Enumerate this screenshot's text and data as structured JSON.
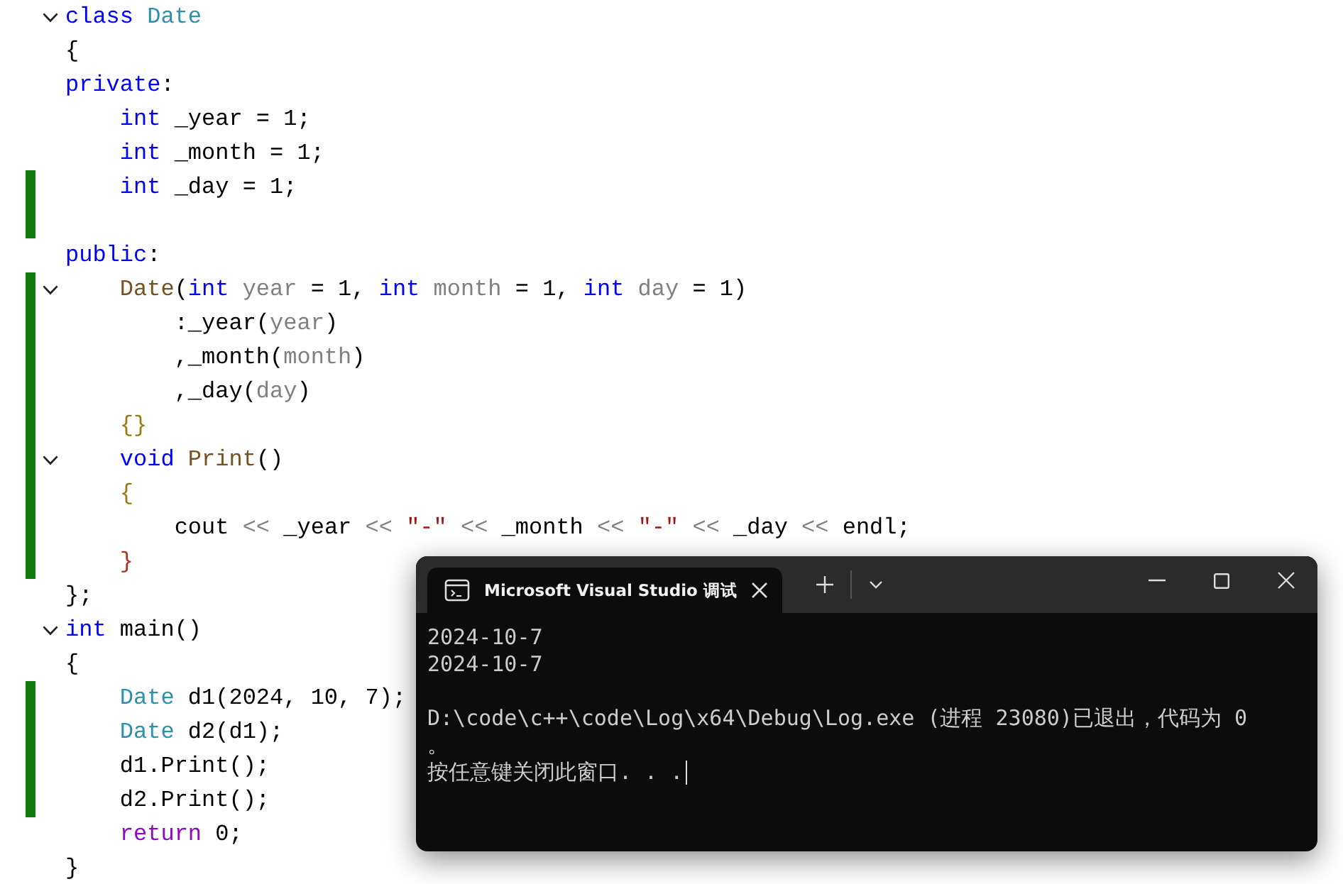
{
  "editor": {
    "lines": [
      {
        "fold": true,
        "changed": false,
        "tokens": [
          {
            "t": "class ",
            "kind": "kw"
          },
          {
            "t": "Date",
            "kind": "type"
          }
        ]
      },
      {
        "fold": false,
        "changed": false,
        "tokens": [
          {
            "t": "{",
            "kind": "plain"
          }
        ]
      },
      {
        "fold": false,
        "changed": false,
        "tokens": [
          {
            "t": "private",
            "kind": "kw"
          },
          {
            "t": ":",
            "kind": "plain"
          }
        ],
        "children": [
          {
            "fold": false,
            "changed": false,
            "tokens": [
              {
                "t": "int ",
                "kind": "kw"
              },
              {
                "t": "_year = 1;",
                "kind": "plain"
              }
            ]
          },
          {
            "fold": false,
            "changed": false,
            "tokens": [
              {
                "t": "int ",
                "kind": "kw"
              },
              {
                "t": "_month = 1;",
                "kind": "plain"
              }
            ]
          },
          {
            "fold": false,
            "changed": true,
            "tokens": [
              {
                "t": "int ",
                "kind": "kw"
              },
              {
                "t": "_day = 1;",
                "kind": "plain"
              }
            ]
          },
          {
            "fold": false,
            "changed": true
          }
        ]
      },
      {
        "fold": false,
        "changed": false,
        "tokens": [
          {
            "t": "public",
            "kind": "kw"
          },
          {
            "t": ":",
            "kind": "plain"
          }
        ],
        "children": [
          {
            "fold": true,
            "changed": true,
            "tokens": [
              {
                "t": "Date",
                "kind": "fn"
              },
              {
                "t": "(",
                "kind": "plain"
              },
              {
                "t": "int ",
                "kind": "kw"
              },
              {
                "t": "year",
                "kind": "param"
              },
              {
                "t": " = 1, ",
                "kind": "plain"
              },
              {
                "t": "int ",
                "kind": "kw"
              },
              {
                "t": "month",
                "kind": "param"
              },
              {
                "t": " = 1, ",
                "kind": "plain"
              },
              {
                "t": "int ",
                "kind": "kw"
              },
              {
                "t": "day",
                "kind": "param"
              },
              {
                "t": " = 1)",
                "kind": "plain"
              }
            ],
            "children": [
              {
                "fold": false,
                "changed": true,
                "tokens": [
                  {
                    "t": ":_year(",
                    "kind": "plain"
                  },
                  {
                    "t": "year",
                    "kind": "param"
                  },
                  {
                    "t": ")",
                    "kind": "plain"
                  }
                ]
              },
              {
                "fold": false,
                "changed": true,
                "tokens": [
                  {
                    "t": ",_month(",
                    "kind": "plain"
                  },
                  {
                    "t": "month",
                    "kind": "param"
                  },
                  {
                    "t": ")",
                    "kind": "plain"
                  }
                ]
              },
              {
                "fold": false,
                "changed": true,
                "tokens": [
                  {
                    "t": ",_day(",
                    "kind": "plain"
                  },
                  {
                    "t": "day",
                    "kind": "param"
                  },
                  {
                    "t": ")",
                    "kind": "plain"
                  }
                ]
              }
            ]
          },
          {
            "fold": false,
            "changed": true,
            "tokens": [
              {
                "t": "{}",
                "kind": "brace"
              }
            ]
          },
          {
            "fold": true,
            "changed": true,
            "tokens": [
              {
                "t": "void ",
                "kind": "kw"
              },
              {
                "t": "Print",
                "kind": "fn"
              },
              {
                "t": "()",
                "kind": "plain"
              }
            ]
          },
          {
            "fold": false,
            "changed": true,
            "tokens": [
              {
                "t": "{",
                "kind": "brace"
              }
            ],
            "children": [
              {
                "fold": false,
                "changed": true,
                "tokens": [
                  {
                    "t": "cout ",
                    "kind": "plain"
                  },
                  {
                    "t": "<<",
                    "kind": "op"
                  },
                  {
                    "t": " _year ",
                    "kind": "plain"
                  },
                  {
                    "t": "<< ",
                    "kind": "op"
                  },
                  {
                    "t": "\"-\"",
                    "kind": "str"
                  },
                  {
                    "t": " << ",
                    "kind": "op"
                  },
                  {
                    "t": "_month ",
                    "kind": "plain"
                  },
                  {
                    "t": "<< ",
                    "kind": "op"
                  },
                  {
                    "t": "\"-\"",
                    "kind": "str"
                  },
                  {
                    "t": " << ",
                    "kind": "op"
                  },
                  {
                    "t": "_day ",
                    "kind": "plain"
                  },
                  {
                    "t": "<<",
                    "kind": "op"
                  },
                  {
                    "t": " endl;",
                    "kind": "plain"
                  }
                ]
              }
            ]
          },
          {
            "fold": false,
            "changed": true,
            "tokens": [
              {
                "t": "}",
                "kind": "brace2"
              }
            ]
          }
        ]
      },
      {
        "fold": false,
        "changed": false,
        "tokens": [
          {
            "t": "};",
            "kind": "plain"
          }
        ]
      },
      {
        "fold": true,
        "changed": false,
        "tokens": [
          {
            "t": "int ",
            "kind": "kw"
          },
          {
            "t": "main()",
            "kind": "plain"
          }
        ]
      },
      {
        "fold": false,
        "changed": false,
        "tokens": [
          {
            "t": "{",
            "kind": "plain"
          }
        ],
        "children": [
          {
            "fold": false,
            "changed": true,
            "tokens": [
              {
                "t": "Date",
                "kind": "type"
              },
              {
                "t": " d1(2024, 10, 7);",
                "kind": "plain"
              }
            ]
          },
          {
            "fold": false,
            "changed": true,
            "tokens": [
              {
                "t": "Date",
                "kind": "type"
              },
              {
                "t": " d2(d1);",
                "kind": "plain"
              }
            ]
          },
          {
            "fold": false,
            "changed": true,
            "tokens": [
              {
                "t": "d1.Print();",
                "kind": "plain"
              }
            ]
          },
          {
            "fold": false,
            "changed": true,
            "tokens": [
              {
                "t": "d2.Print();",
                "kind": "plain"
              }
            ]
          },
          {
            "fold": false,
            "changed": false,
            "tokens": [
              {
                "t": "return",
                "kind": "ctrl"
              },
              {
                "t": " 0;",
                "kind": "plain"
              }
            ]
          }
        ]
      },
      {
        "fold": false,
        "changed": false,
        "tokens": [
          {
            "t": "}",
            "kind": "plain"
          }
        ]
      }
    ]
  },
  "terminal": {
    "tab": {
      "title": "Microsoft Visual Studio 调试",
      "selected": true
    },
    "lines": [
      {
        "kind": "text",
        "text": "2024-10-7"
      },
      {
        "kind": "text",
        "text": "2024-10-7"
      },
      {
        "kind": "blank"
      },
      {
        "kind": "text",
        "text": "D:\\code\\c++\\code\\Log\\x64\\Debug\\Log.exe (进程 23080)已退出，代码为 0"
      },
      {
        "kind": "text",
        "text": "。"
      },
      {
        "kind": "text",
        "text": "按任意键关闭此窗口. . .",
        "cursor": true
      }
    ]
  }
}
